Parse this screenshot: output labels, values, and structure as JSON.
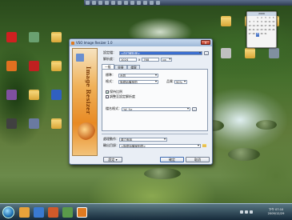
{
  "desktop": {
    "icons_left": [
      {
        "label": "",
        "icon": "adobe-reader-icon",
        "color": "#d02020"
      },
      {
        "label": "",
        "icon": "anime-app-icon",
        "color": "#6aa070"
      },
      {
        "label": "",
        "icon": "folder-icon",
        "color": "#e0b040"
      },
      {
        "label": "",
        "icon": "firefox-icon",
        "color": "#e07020"
      },
      {
        "label": "",
        "icon": "app-icon",
        "color": "#c02020"
      },
      {
        "label": "",
        "icon": "folder-icon",
        "color": "#e0b040"
      },
      {
        "label": "",
        "icon": "anime-app-icon",
        "color": "#8050a0"
      },
      {
        "label": "",
        "icon": "folder-icon",
        "color": "#e0b040"
      },
      {
        "label": "",
        "icon": "windows-live-icon",
        "color": "#3060c0"
      },
      {
        "label": "",
        "icon": "app-icon",
        "color": "#404040"
      },
      {
        "label": "",
        "icon": "anime-app-icon",
        "color": "#6a7aa0"
      },
      {
        "label": "",
        "icon": "folder-icon",
        "color": "#e0b040"
      }
    ],
    "icons_right": [
      {
        "label": "",
        "icon": "folder-icon",
        "color": "#e0b040"
      },
      {
        "label": "",
        "icon": "folder-icon",
        "color": "#e0b040"
      },
      {
        "label": "",
        "icon": "folder-icon",
        "color": "#e0b040"
      },
      {
        "label": "",
        "icon": "disc-icon",
        "color": "#c0c0c0"
      },
      {
        "label": "",
        "icon": "folder-icon",
        "color": "#e0b040"
      },
      {
        "label": "",
        "icon": "computer-icon",
        "color": "#8090a0"
      }
    ]
  },
  "calendar": {
    "header": "2009",
    "days": [
      "",
      "",
      "1",
      "2",
      "3",
      "4",
      "5",
      "6",
      "7",
      "8",
      "9",
      "10",
      "11",
      "12",
      "13",
      "14",
      "15",
      "16",
      "17",
      "18",
      "19",
      "20",
      "21",
      "22",
      "23",
      "24",
      "25",
      "26",
      "27",
      "28",
      "29",
      "30",
      "31",
      "",
      ""
    ],
    "today": "29"
  },
  "dialog": {
    "title": "VSO Image Resizer 1.0",
    "close_label": "✕",
    "banner_text": "Image Resizer",
    "profile_label": "設定檔：",
    "profile_value": "<自訂解析度>",
    "resolution_label": "解析度：",
    "width_value": "1024",
    "x_label": "x",
    "height_value": "768",
    "unit_value": "px",
    "tabs": [
      "一般",
      "效果",
      "檔案"
    ],
    "quality_label": "標準：",
    "quality_value": "品質",
    "format_label": "格式：",
    "format_value": "與原始檔相同",
    "level_label": "品質：",
    "level_value": "90%",
    "checkbox1_label": "保持比例",
    "checkbox2_label": "調整至設定解析度",
    "filename_label": "檔名格式：",
    "filename_value": "%f_%r",
    "action_label": "處理動作：",
    "action_value": "建立副本",
    "output_label": "輸出目錄：",
    "output_value": "<與原始檔案相同>",
    "settings_button": "設定",
    "ok_button": "確定",
    "cancel_button": "取消",
    "settings_button_arrow": "▾"
  },
  "taskbar": {
    "clock_time": "下午 07:10",
    "clock_date": "2009/12/29"
  }
}
